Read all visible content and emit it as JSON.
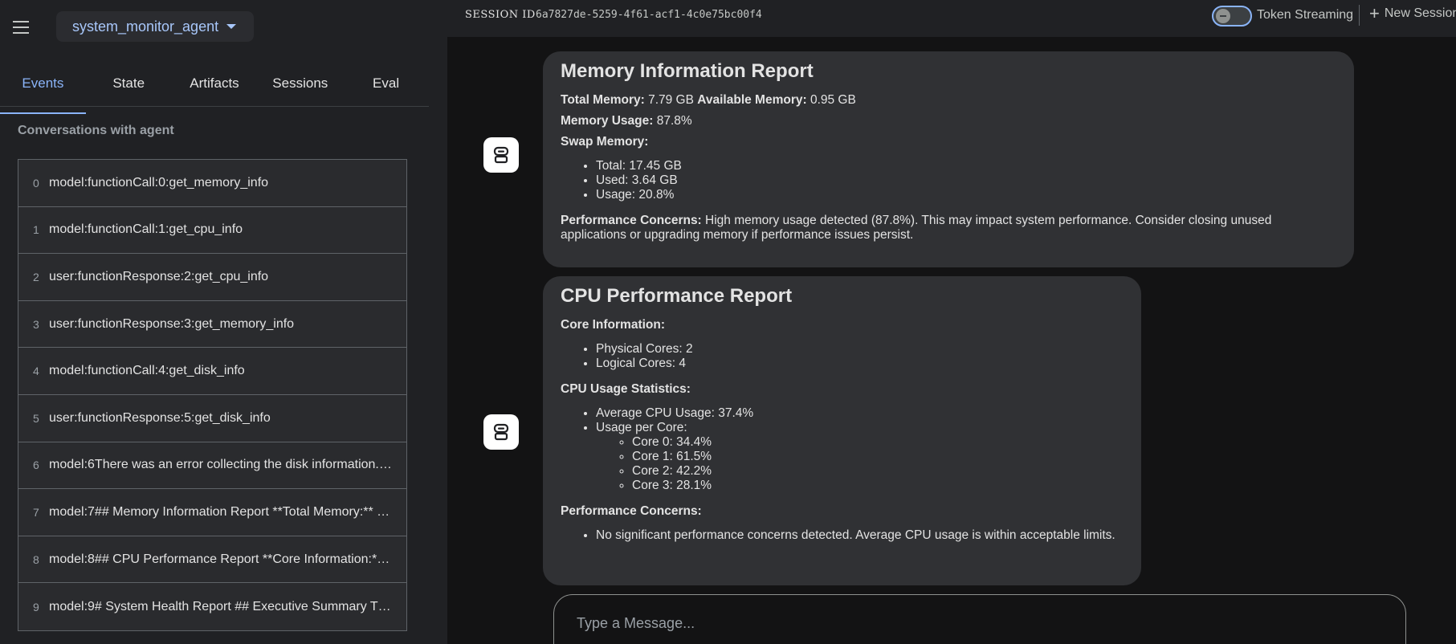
{
  "app": {
    "selected_agent": "system_monitor_agent"
  },
  "tabs": [
    {
      "label": "Events"
    },
    {
      "label": "State"
    },
    {
      "label": "Artifacts"
    },
    {
      "label": "Sessions"
    },
    {
      "label": "Eval"
    }
  ],
  "events": {
    "title": "Conversations with agent",
    "items": [
      {
        "index": "0",
        "text": "model:functionCall:0:get_memory_info"
      },
      {
        "index": "1",
        "text": "model:functionCall:1:get_cpu_info"
      },
      {
        "index": "2",
        "text": "user:functionResponse:2:get_cpu_info"
      },
      {
        "index": "3",
        "text": "user:functionResponse:3:get_memory_info"
      },
      {
        "index": "4",
        "text": "model:functionCall:4:get_disk_info"
      },
      {
        "index": "5",
        "text": "user:functionResponse:5:get_disk_info"
      },
      {
        "index": "6",
        "text": "model:6There was an error collecting the disk information. …"
      },
      {
        "index": "7",
        "text": "model:7## Memory Information Report **Total Memory:** 7…"
      },
      {
        "index": "8",
        "text": "model:8## CPU Performance Report **Core Information:**…"
      },
      {
        "index": "9",
        "text": "model:9# System Health Report ## Executive Summary T…"
      }
    ]
  },
  "topbar": {
    "session_label": "SESSION ID",
    "session_id": "6a7827de-5259-4f61-acf1-4c0e75bc00f4",
    "streaming_label": "Token Streaming",
    "streaming_enabled": false,
    "new_session_label": "New Session"
  },
  "messages": {
    "memory": {
      "title": "Memory Information Report",
      "total_label": "Total Memory:",
      "total_value": " 7.79 GB ",
      "available_label": "Available Memory:",
      "available_value": " 0.95 GB",
      "usage_label": "Memory Usage:",
      "usage_value": " 87.8%",
      "swap_label": "Swap Memory:",
      "swap_items": [
        "Total: 17.45 GB",
        "Used: 3.64 GB",
        "Usage: 20.8%"
      ],
      "concerns_label": "Performance Concerns:",
      "concerns_text": " High memory usage detected (87.8%). This may impact system performance. Consider closing unused applications or upgrading memory if performance issues persist."
    },
    "cpu": {
      "title": "CPU Performance Report",
      "core_label": "Core Information:",
      "core_items": [
        "Physical Cores: 2",
        "Logical Cores: 4"
      ],
      "stats_label": "CPU Usage Statistics:",
      "avg_usage": "Average CPU Usage: 37.4%",
      "per_core_label": "Usage per Core:",
      "per_core_items": [
        "Core 0: 34.4%",
        "Core 1: 61.5%",
        "Core 2: 42.2%",
        "Core 3: 28.1%"
      ],
      "concerns_label": "Performance Concerns:",
      "concerns_items": [
        "No significant performance concerns detected. Average CPU usage is within acceptable limits."
      ]
    }
  },
  "composer": {
    "placeholder": "Type a Message..."
  },
  "colors": {
    "accent": "#8ab4f8",
    "sidebar_bg": "#202124",
    "bubble_bg": "#303134",
    "page_bg": "#131314"
  }
}
